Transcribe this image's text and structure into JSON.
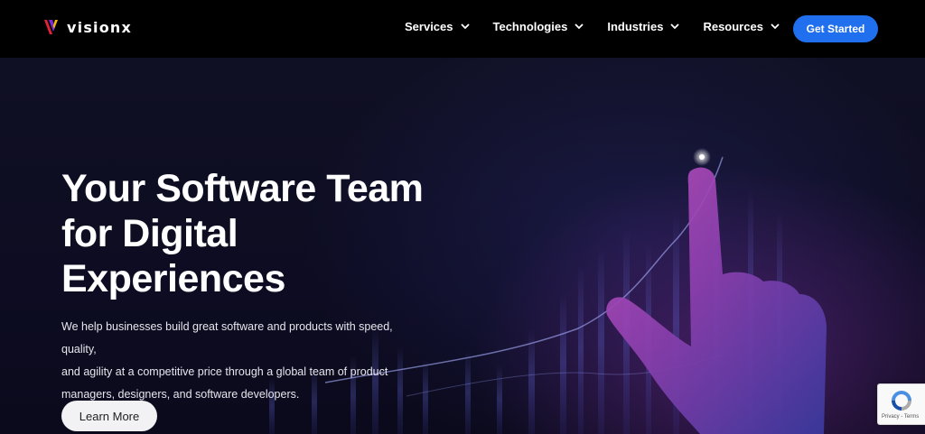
{
  "brand": {
    "name": "visionx",
    "colors": {
      "red": "#e8213a",
      "purple": "#7a2bd8",
      "yellow": "#f5b800"
    }
  },
  "nav": {
    "items": [
      {
        "label": "Services",
        "icon": "chevron-down-icon"
      },
      {
        "label": "Technologies",
        "icon": "chevron-down-icon"
      },
      {
        "label": "Industries",
        "icon": "chevron-down-icon"
      },
      {
        "label": "Resources",
        "icon": "chevron-down-icon"
      }
    ],
    "cta_label": "Get Started"
  },
  "hero": {
    "headline_line1": "Your Software Team",
    "headline_line2": "for Digital",
    "headline_line3": "Experiences",
    "subcopy_line1": "We help businesses build great software and products with speed, quality,",
    "subcopy_line2": "and agility at a competitive price through a global team of product",
    "subcopy_line3": "managers, designers, and software developers.",
    "button_label": "Learn More"
  },
  "recaptcha": {
    "text": "Privacy - Terms",
    "icon": "recaptcha-icon"
  },
  "colors": {
    "accent": "#1f6fee",
    "header_bg": "#000000",
    "hero_bg": "#0d0c22"
  }
}
